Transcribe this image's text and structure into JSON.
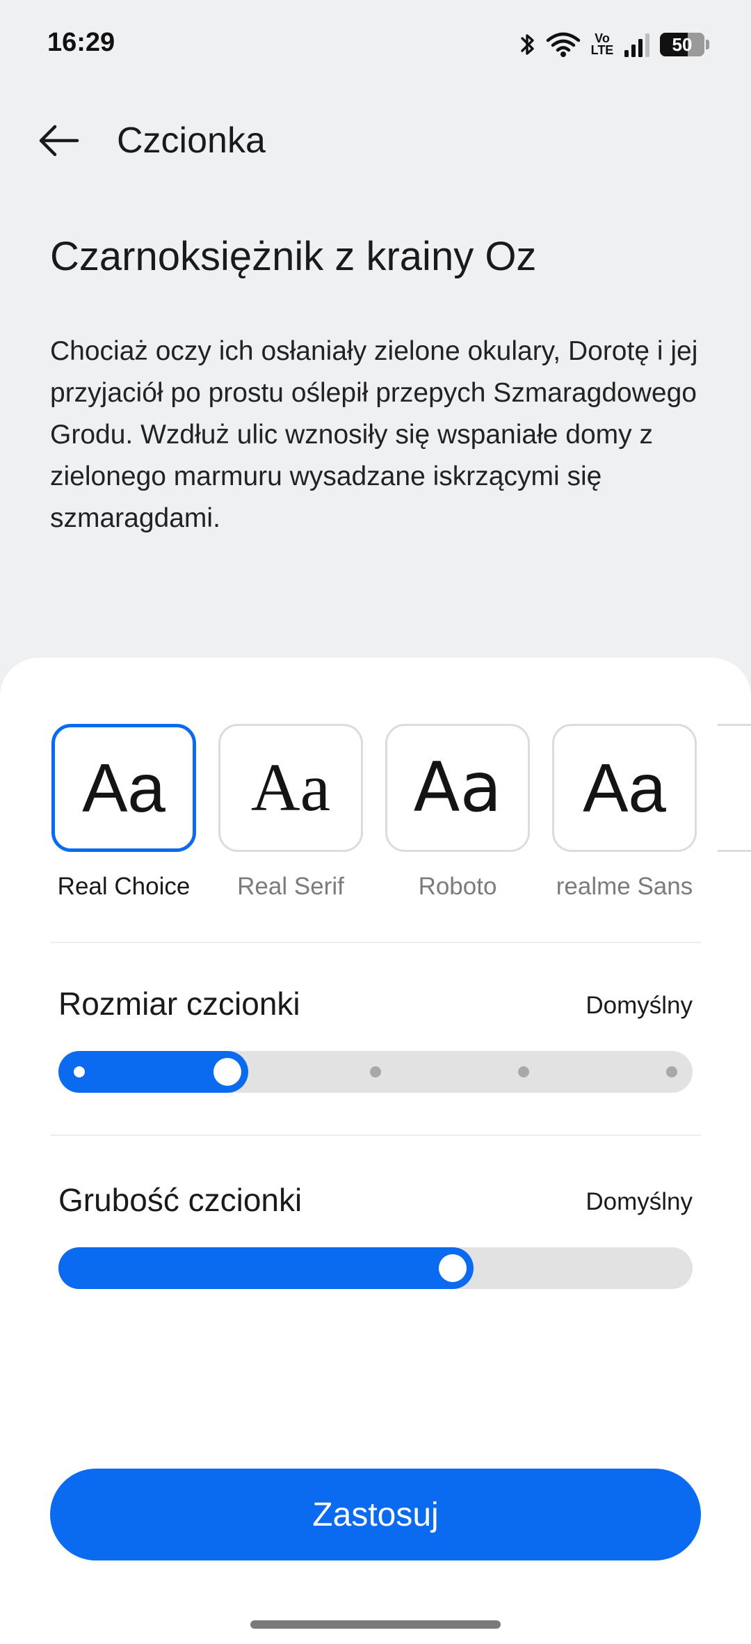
{
  "status_bar": {
    "time": "16:29",
    "network_label": "Vo LTE",
    "battery": "50",
    "icons": [
      "bluetooth-icon",
      "wifi-icon",
      "volte-icon",
      "signal-icon",
      "battery-icon"
    ]
  },
  "header": {
    "title": "Czcionka",
    "back_icon": "arrow-left-icon"
  },
  "preview": {
    "title": "Czarnoksiężnik z krainy Oz",
    "body": "Chociaż oczy ich osłaniały zielone okulary, Dorotę i jej przyjaciół po prostu oślepił przepych Szmaragdowego Grodu. Wzdłuż ulic wznosiły się wspaniałe domy z zielonego marmuru wysadzane iskrzącymi się szmaragdami."
  },
  "fonts": {
    "sample": "Aa",
    "options": [
      {
        "label": "Real Choice",
        "selected": true
      },
      {
        "label": "Real Serif",
        "selected": false
      },
      {
        "label": "Roboto",
        "selected": false
      },
      {
        "label": "realme Sans",
        "selected": false
      }
    ]
  },
  "font_size": {
    "label": "Rozmiar czcionki",
    "value": "Domyślny",
    "steps": 5,
    "selected_step": 2
  },
  "font_weight": {
    "label": "Grubość czcionki",
    "value": "Domyślny",
    "level": 0.63
  },
  "apply_button": {
    "label": "Zastosuj"
  },
  "colors": {
    "accent": "#0a6bf0",
    "background": "#eff0f2",
    "sheet": "#ffffff"
  }
}
